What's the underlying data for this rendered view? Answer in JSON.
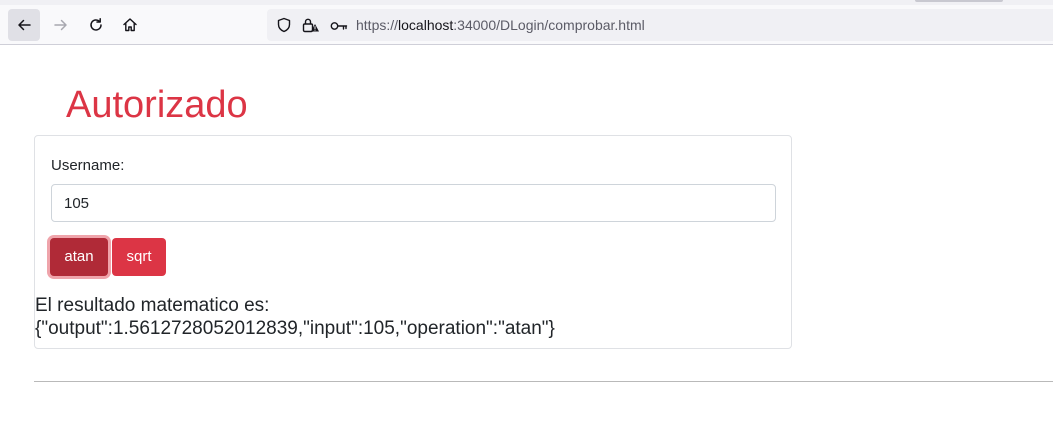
{
  "browser": {
    "url_prefix": "https://",
    "url_host": "localhost",
    "url_rest": ":34000/DLogin/comprobar.html"
  },
  "page": {
    "title": "Autorizado",
    "username_label": "Username:",
    "username_value": "105",
    "buttons": {
      "atan": "atan",
      "sqrt": "sqrt"
    },
    "result_label": "El resultado matematico es:",
    "result_value": "{\"output\":1.5612728052012839,\"input\":105,\"operation\":\"atan\"}"
  },
  "colors": {
    "accent": "#dc3545",
    "accent_active": "#b02a37"
  },
  "icons": [
    "back-arrow-icon",
    "forward-arrow-icon",
    "reload-icon",
    "home-icon",
    "shield-icon",
    "lock-warning-icon",
    "key-icon"
  ]
}
